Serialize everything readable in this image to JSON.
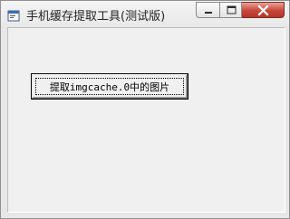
{
  "window": {
    "title": "手机缓存提取工具(测试版)",
    "icon": "app-form-icon",
    "controls": {
      "minimize_icon": "minimize-icon",
      "maximize_icon": "maximize-icon",
      "close_icon": "close-icon"
    },
    "colors": {
      "close_button": "#c7473a",
      "client_background": "#f0f0f0"
    }
  },
  "main": {
    "extract_button_label": "提取imgcache.0中的图片"
  }
}
